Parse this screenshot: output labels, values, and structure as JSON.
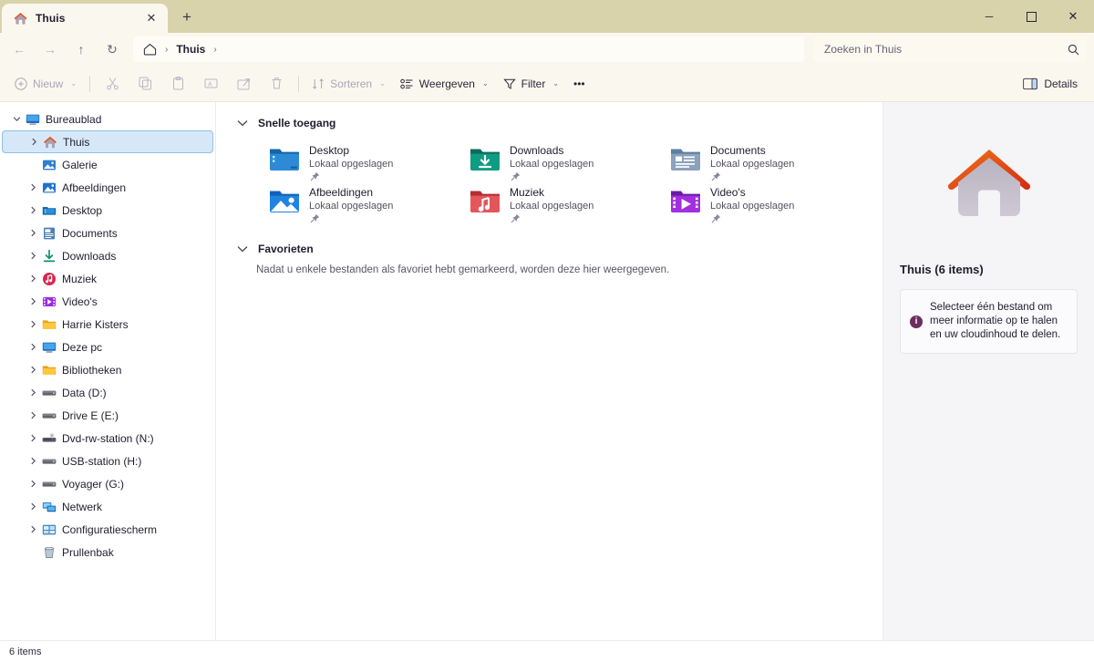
{
  "titlebar": {
    "tab": {
      "title": "Thuis",
      "icon": "home-icon",
      "close_label": "✕"
    },
    "newtab_label": "+",
    "controls": {
      "minimize": "─",
      "maximize": "☐",
      "close": "✕"
    }
  },
  "addressbar": {
    "back": "←",
    "forward": "→",
    "up": "↑",
    "refresh": "↻",
    "breadcrumb": {
      "home_icon": "home-icon",
      "sep": "›",
      "text": "Thuis",
      "trailing_sep": "›"
    },
    "search": {
      "placeholder": "Zoeken in Thuis",
      "value": "",
      "icon": "search-icon"
    }
  },
  "toolbar": {
    "new_label": "Nieuw",
    "cut_label": "Knippen",
    "copy_label": "Kopiëren",
    "paste_label": "Plakken",
    "rename_label": "Naam wijzigen",
    "share_label": "Delen",
    "delete_label": "Verwijderen",
    "sort_label": "Sorteren",
    "view_label": "Weergeven",
    "filter_label": "Filter",
    "more_label": "•••",
    "details_label": "Details",
    "caret": "⌄"
  },
  "sidebar": {
    "items": [
      {
        "label": "Bureaublad",
        "icon": "desktop-icon",
        "chevron": "open",
        "level": 1,
        "selected": false
      },
      {
        "label": "Thuis",
        "icon": "home-icon",
        "chevron": "closed",
        "level": 2,
        "selected": true
      },
      {
        "label": "Galerie",
        "icon": "gallery-icon",
        "chevron": "none",
        "level": 2,
        "selected": false
      },
      {
        "label": "Afbeeldingen",
        "icon": "pictures-icon",
        "chevron": "closed",
        "level": 2,
        "selected": false
      },
      {
        "label": "Desktop",
        "icon": "desktop-folder-icon",
        "chevron": "closed",
        "level": 2,
        "selected": false
      },
      {
        "label": "Documents",
        "icon": "documents-icon",
        "chevron": "closed",
        "level": 2,
        "selected": false
      },
      {
        "label": "Downloads",
        "icon": "downloads-icon",
        "chevron": "closed",
        "level": 2,
        "selected": false
      },
      {
        "label": "Muziek",
        "icon": "music-icon",
        "chevron": "closed",
        "level": 2,
        "selected": false
      },
      {
        "label": "Video's",
        "icon": "videos-icon",
        "chevron": "closed",
        "level": 2,
        "selected": false
      },
      {
        "label": "Harrie Kisters",
        "icon": "folder-icon",
        "chevron": "closed",
        "level": 2,
        "selected": false
      },
      {
        "label": "Deze pc",
        "icon": "pc-icon",
        "chevron": "closed",
        "level": 2,
        "selected": false
      },
      {
        "label": "Bibliotheken",
        "icon": "folder-icon",
        "chevron": "closed",
        "level": 2,
        "selected": false
      },
      {
        "label": "Data (D:)",
        "icon": "drive-icon",
        "chevron": "closed",
        "level": 2,
        "selected": false
      },
      {
        "label": "Drive E (E:)",
        "icon": "drive-icon",
        "chevron": "closed",
        "level": 2,
        "selected": false
      },
      {
        "label": "Dvd-rw-station (N:)",
        "icon": "dvd-drive-icon",
        "chevron": "closed",
        "level": 2,
        "selected": false
      },
      {
        "label": "USB-station (H:)",
        "icon": "drive-icon",
        "chevron": "closed",
        "level": 2,
        "selected": false
      },
      {
        "label": "Voyager (G:)",
        "icon": "drive-icon",
        "chevron": "closed",
        "level": 2,
        "selected": false
      },
      {
        "label": "Netwerk",
        "icon": "network-icon",
        "chevron": "closed",
        "level": 2,
        "selected": false
      },
      {
        "label": "Configuratiescherm",
        "icon": "control-panel-icon",
        "chevron": "closed",
        "level": 2,
        "selected": false
      },
      {
        "label": "Prullenbak",
        "icon": "recycle-bin-icon",
        "chevron": "none",
        "level": 2,
        "selected": false
      }
    ]
  },
  "main": {
    "quick_access": {
      "title": "Snelle toegang",
      "chevron": "⌄",
      "tiles": [
        {
          "name": "Desktop",
          "subtitle": "Lokaal opgeslagen",
          "icon": "desktop-folder-icon",
          "pinned": true
        },
        {
          "name": "Downloads",
          "subtitle": "Lokaal opgeslagen",
          "icon": "downloads-folder-icon",
          "pinned": true
        },
        {
          "name": "Documents",
          "subtitle": "Lokaal opgeslagen",
          "icon": "documents-folder-icon",
          "pinned": true
        },
        {
          "name": "Afbeeldingen",
          "subtitle": "Lokaal opgeslagen",
          "icon": "pictures-folder-icon",
          "pinned": true
        },
        {
          "name": "Muziek",
          "subtitle": "Lokaal opgeslagen",
          "icon": "music-folder-icon",
          "pinned": true
        },
        {
          "name": "Video's",
          "subtitle": "Lokaal opgeslagen",
          "icon": "videos-folder-icon",
          "pinned": true
        }
      ]
    },
    "favorites": {
      "title": "Favorieten",
      "chevron": "⌄",
      "empty_text": "Nadat u enkele bestanden als favoriet hebt gemarkeerd, worden deze hier weergegeven."
    }
  },
  "details_pane": {
    "hero_icon": "home-icon",
    "title": "Thuis (6 items)",
    "info_icon": "info-icon",
    "info_text": "Selecteer één bestand om meer informatie op te halen en uw cloudinhoud te delen."
  },
  "statusbar": {
    "item_count": "6 items"
  },
  "colors": {
    "titlebar": "#d8d3ab",
    "tab_active": "#faf8ee",
    "toolbar": "#faf8ee",
    "selection": "#d6e8f8",
    "selection_border": "#8fc0e8",
    "details_pane": "#f5f4f7",
    "accent_info": "#6b2e5f",
    "roof": "#e8531f"
  }
}
